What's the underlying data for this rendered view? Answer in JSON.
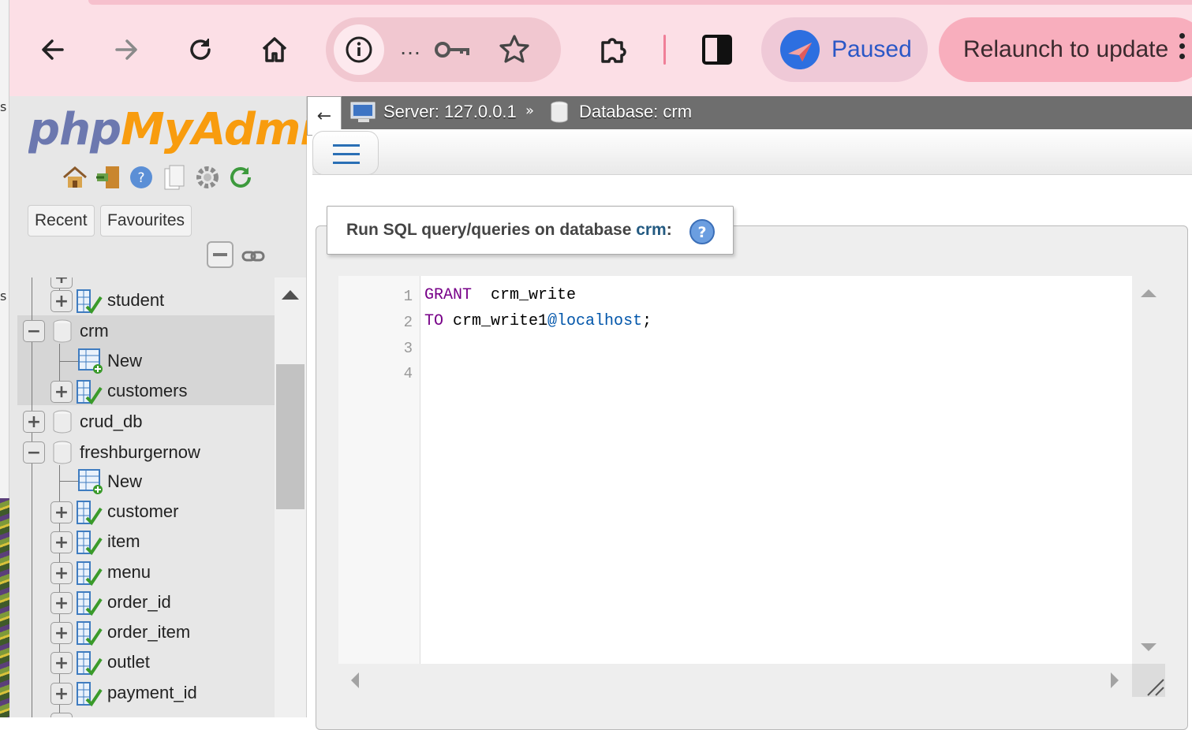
{
  "desktop": {
    "edge_marks": [
      "s",
      "s"
    ]
  },
  "browser": {
    "nav_icons": [
      "back-arrow-icon",
      "forward-arrow-icon",
      "reload-icon",
      "home-icon"
    ],
    "omnibox": {
      "collapsed_url": "…",
      "icons": [
        "info-icon",
        "key-icon",
        "bookmark-star-icon"
      ]
    },
    "extensions_icon": "puzzle-icon",
    "side_panel_icon": "side-panel-icon",
    "profile": {
      "label": "Paused"
    },
    "relaunch": {
      "label": "Relaunch to update"
    },
    "colors": {
      "toolbar": "#fcdfe6",
      "relaunch": "#f8aebd",
      "paused": "#2a57c6"
    }
  },
  "pma": {
    "logo": {
      "php": "php",
      "myadmin": "MyAdmin"
    },
    "logo_icons": [
      "home-icon",
      "logout-icon",
      "help-icon",
      "docs-icon",
      "settings-icon",
      "reload-icon"
    ],
    "tabs": {
      "recent": "Recent",
      "favourites": "Favourites"
    },
    "tree": {
      "student": "student",
      "crm": "crm",
      "crm_new": "New",
      "customers": "customers",
      "crud_db": "crud_db",
      "freshburgernow": "freshburgernow",
      "fbn_new": "New",
      "customer": "customer",
      "item": "item",
      "menu": "menu",
      "order_id": "order_id",
      "order_item": "order_item",
      "outlet": "outlet",
      "payment_id": "payment_id"
    },
    "breadcrumb": {
      "server": "Server: 127.0.0.1",
      "separator": "»",
      "database": "Database: crm"
    },
    "back_arrow": "←",
    "query_box": {
      "title_prefix": "Run SQL query/queries on database ",
      "db": "crm",
      "title_suffix": ":"
    },
    "editor": {
      "line_numbers": [
        "1",
        "2",
        "3",
        "4"
      ],
      "line1": {
        "kw": "GRANT",
        "rest": "  crm_write"
      },
      "line2": {
        "kw": "TO",
        "user": " crm_write1",
        "host": "@localhost",
        "end": ";"
      }
    }
  }
}
